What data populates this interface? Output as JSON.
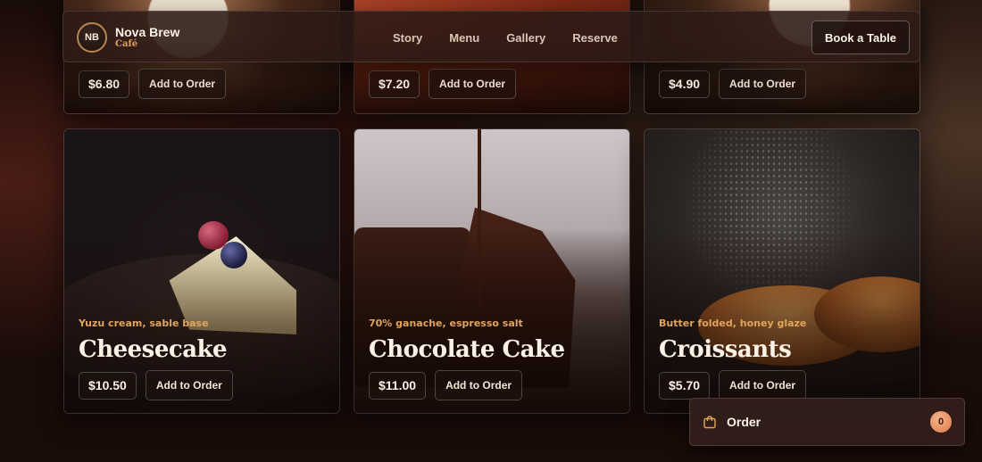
{
  "brand": {
    "initials": "NB",
    "name": "Nova Brew",
    "subtitle": "Café"
  },
  "nav": {
    "links": [
      "Story",
      "Menu",
      "Gallery",
      "Reserve"
    ],
    "cta_label": "Book a Table"
  },
  "menu_items_top": [
    {
      "price": "$6.80",
      "button_label": "Add to Order"
    },
    {
      "price": "$7.20",
      "button_label": "Add to Order"
    },
    {
      "price": "$4.90",
      "button_label": "Add to Order"
    }
  ],
  "menu_items": [
    {
      "subtitle": "Yuzu cream, sable base",
      "title": "Cheesecake",
      "price": "$10.50",
      "button_label": "Add to Order"
    },
    {
      "subtitle": "70% ganache, espresso salt",
      "title": "Chocolate Cake",
      "price": "$11.00",
      "button_label": "Add to Order"
    },
    {
      "subtitle": "Butter folded, honey glaze",
      "title": "Croissants",
      "price": "$5.70",
      "button_label": "Add to Order"
    }
  ],
  "order": {
    "label": "Order",
    "count": "0"
  },
  "colors": {
    "accent": "#e0a45e",
    "badge": "#e88a5a",
    "background": "#1a0c09"
  }
}
